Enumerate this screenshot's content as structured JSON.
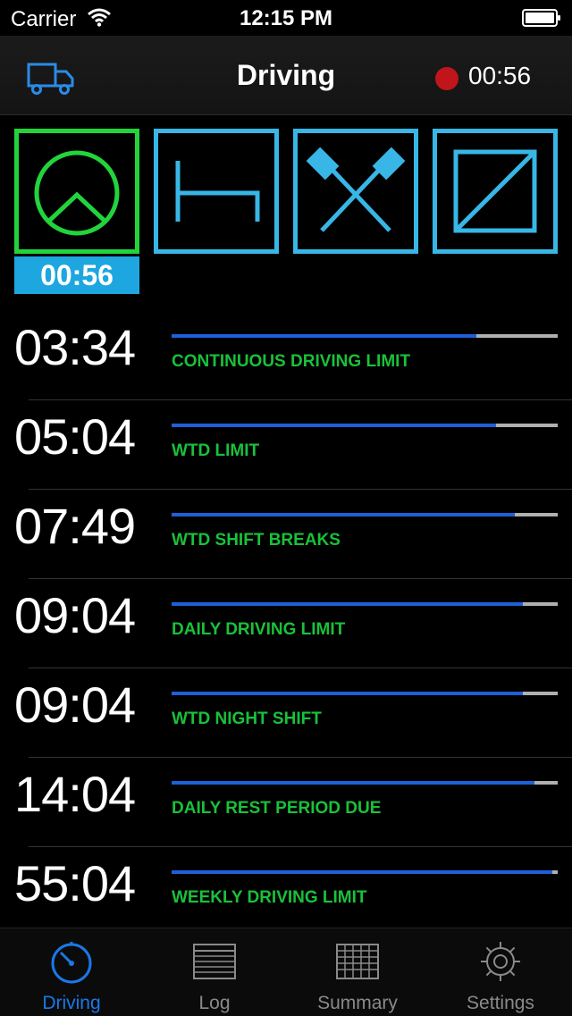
{
  "status_bar": {
    "carrier": "Carrier",
    "time": "12:15 PM"
  },
  "nav": {
    "title": "Driving",
    "timer": "00:56",
    "record_color": "#c0151b"
  },
  "modes": [
    {
      "name": "driving",
      "icon": "driving-mode-icon",
      "selected": true,
      "color": "#22d43c"
    },
    {
      "name": "rest",
      "icon": "rest-bed-icon",
      "selected": false,
      "color": "#38b6e6"
    },
    {
      "name": "other-work",
      "icon": "crossed-hammers-icon",
      "selected": false,
      "color": "#38b6e6"
    },
    {
      "name": "availability",
      "icon": "availability-box-icon",
      "selected": false,
      "color": "#38b6e6"
    }
  ],
  "active_mode_timer": "00:56",
  "limits": [
    {
      "time": "03:34",
      "label": "CONTINUOUS DRIVING LIMIT",
      "progress": 0.79
    },
    {
      "time": "05:04",
      "label": "WTD LIMIT",
      "progress": 0.84
    },
    {
      "time": "07:49",
      "label": "WTD SHIFT BREAKS",
      "progress": 0.89
    },
    {
      "time": "09:04",
      "label": "DAILY DRIVING LIMIT",
      "progress": 0.91
    },
    {
      "time": "09:04",
      "label": "WTD NIGHT SHIFT",
      "progress": 0.91
    },
    {
      "time": "14:04",
      "label": "DAILY REST PERIOD DUE",
      "progress": 0.94
    },
    {
      "time": "55:04",
      "label": "WEEKLY DRIVING LIMIT",
      "progress": 0.985
    }
  ],
  "tabs": [
    {
      "label": "Driving",
      "icon": "stopwatch-icon",
      "active": true
    },
    {
      "label": "Log",
      "icon": "list-grid-icon",
      "active": false
    },
    {
      "label": "Summary",
      "icon": "table-grid-icon",
      "active": false
    },
    {
      "label": "Settings",
      "icon": "gear-icon",
      "active": false
    }
  ],
  "colors": {
    "accent": "#1a78e8",
    "limit_label": "#19c13a",
    "bar_fill": "#1f5fd8",
    "bar_track": "#b0b0b0"
  }
}
